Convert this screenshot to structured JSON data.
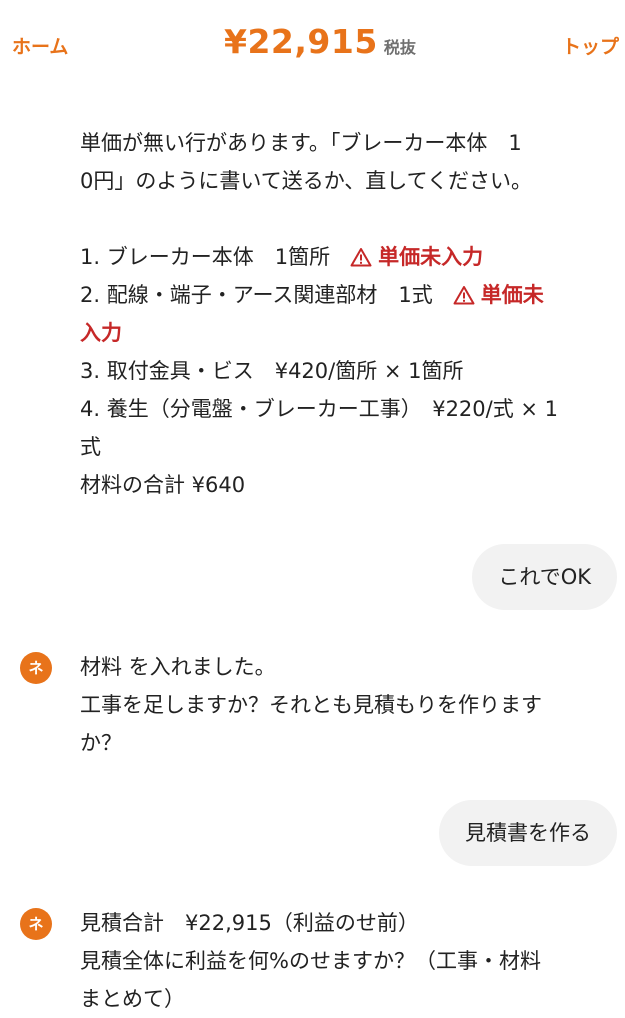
{
  "header": {
    "home_label": "ホーム",
    "top_label": "トップ",
    "total_amount": "¥22,915",
    "tax_label": "税抜"
  },
  "messages": {
    "warning_msg": {
      "intro_line1": "単価が無い行があります。「ブレーカー本体　1",
      "intro_line2": "0円」のように書いて送るか、直してください。",
      "item1_text": "1. ブレーカー本体　1箇所",
      "item1_warning": "単価未入力",
      "item2_text": "2. 配線・端子・アース関連部材　1式",
      "item2_warning_part1": "単価未",
      "item2_warning_part2": "入力",
      "item3_text": "3. 取付金具・ビス　¥420/箇所 × 1箇所",
      "item4_text_line1": "4. 養生（分電盤・ブレーカー工事）　¥220/式 × 1",
      "item4_text_line2": "式",
      "subtotal": "材料の合計 ¥640"
    },
    "user_reply_1": "これでOK",
    "bot_msg_2": {
      "avatar": "ネ",
      "line1": "材料 を入れました。",
      "line2": "工事を足しますか？それとも見積もりを作りますか？",
      "line2_a": "工事を足しますか？それとも見積もりを作ります",
      "line2_b": "か？"
    },
    "user_reply_2": "見積書を作る",
    "bot_msg_3": {
      "avatar": "ネ",
      "line1": "見積合計　¥22,915（利益のせ前）",
      "line2": "見積全体に利益を何%のせますか？（工事・材料",
      "line3": "まとめて）"
    }
  },
  "colors": {
    "accent": "#e8731a",
    "warning": "#c62828",
    "bubble": "#f2f2f2"
  },
  "icons": {
    "warning": "warning-triangle-icon"
  }
}
